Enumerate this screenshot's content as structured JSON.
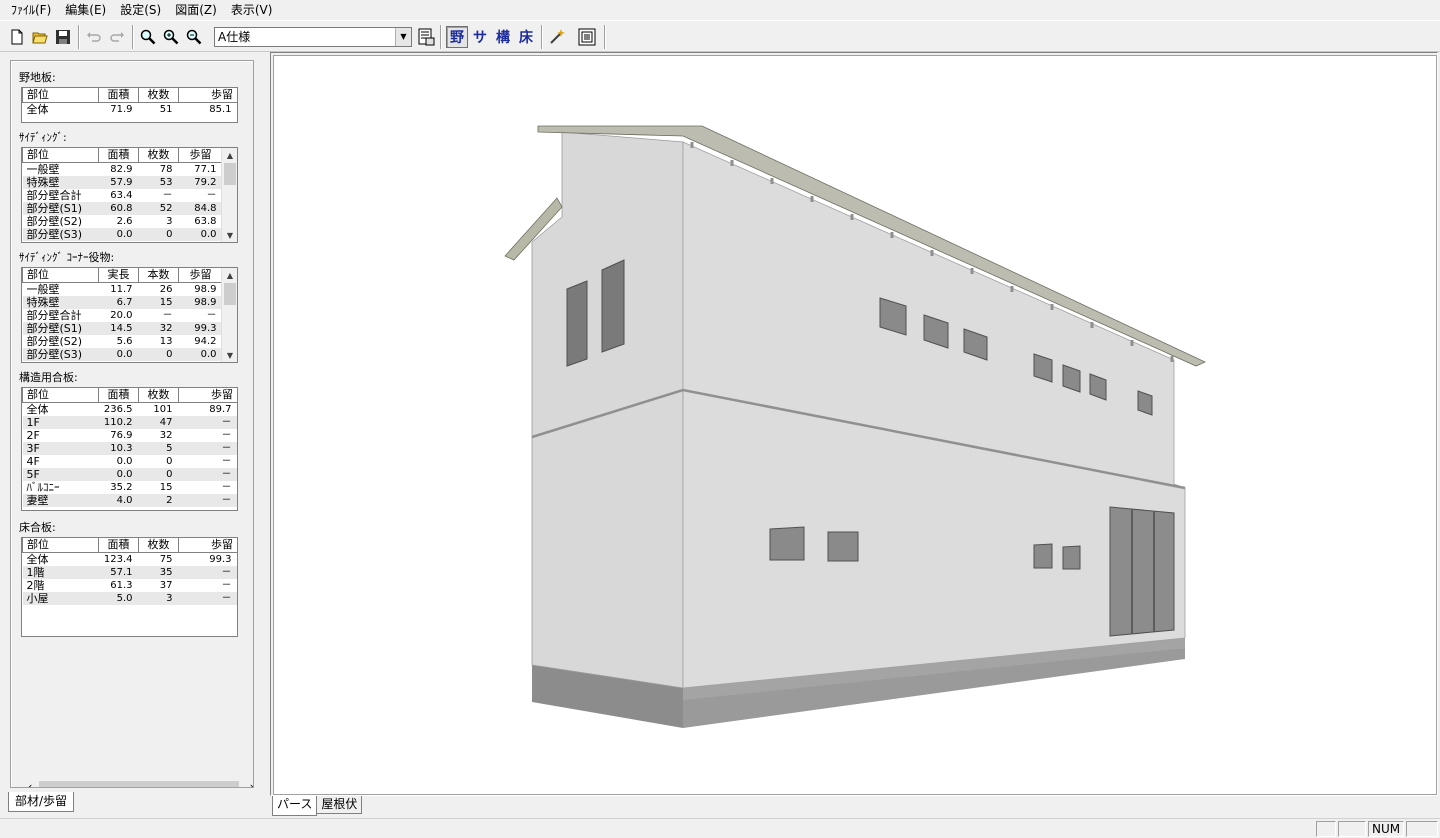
{
  "menu": [
    "ﾌｧｲﾙ(F)",
    "編集(E)",
    "設定(S)",
    "図面(Z)",
    "表示(V)"
  ],
  "toolbar": {
    "spec_value": "A仕様",
    "btn_nojiita": "野",
    "btn_siding": "サ",
    "btn_kouzou": "構",
    "btn_yuka": "床"
  },
  "panel": {
    "nojiita": {
      "title": "野地板:",
      "headers": [
        "部位",
        "面積",
        "枚数",
        "歩留"
      ],
      "rows": [
        [
          "全体",
          "71.9",
          "51",
          "85.1"
        ]
      ]
    },
    "siding": {
      "title": "ｻｲﾃﾞｨﾝｸﾞ:",
      "headers": [
        "部位",
        "面積",
        "枚数",
        "歩留"
      ],
      "rows": [
        [
          "一般壁",
          "82.9",
          "78",
          "77.1"
        ],
        [
          "特殊壁",
          "57.9",
          "53",
          "79.2"
        ],
        [
          "部分壁合計",
          "63.4",
          "－",
          "－"
        ],
        [
          "部分壁(S1)",
          "60.8",
          "52",
          "84.8"
        ],
        [
          "部分壁(S2)",
          "2.6",
          "3",
          "63.8"
        ],
        [
          "部分壁(S3)",
          "0.0",
          "0",
          "0.0"
        ]
      ]
    },
    "corner": {
      "title": "ｻｲﾃﾞｨﾝｸﾞ ｺｰﾅｰ役物:",
      "headers": [
        "部位",
        "実長",
        "本数",
        "歩留"
      ],
      "rows": [
        [
          "一般壁",
          "11.7",
          "26",
          "98.9"
        ],
        [
          "特殊壁",
          "6.7",
          "15",
          "98.9"
        ],
        [
          "部分壁合計",
          "20.0",
          "－",
          "－"
        ],
        [
          "部分壁(S1)",
          "14.5",
          "32",
          "99.3"
        ],
        [
          "部分壁(S2)",
          "5.6",
          "13",
          "94.2"
        ],
        [
          "部分壁(S3)",
          "0.0",
          "0",
          "0.0"
        ]
      ]
    },
    "kouzou": {
      "title": "構造用合板:",
      "headers": [
        "部位",
        "面積",
        "枚数",
        "歩留"
      ],
      "rows": [
        [
          "全体",
          "236.5",
          "101",
          "89.7"
        ],
        [
          "1F",
          "110.2",
          "47",
          "－"
        ],
        [
          "2F",
          "76.9",
          "32",
          "－"
        ],
        [
          "3F",
          "10.3",
          "5",
          "－"
        ],
        [
          "4F",
          "0.0",
          "0",
          "－"
        ],
        [
          "5F",
          "0.0",
          "0",
          "－"
        ],
        [
          "ﾊﾞﾙｺﾆｰ",
          "35.2",
          "15",
          "－"
        ],
        [
          "妻壁",
          "4.0",
          "2",
          "－"
        ]
      ]
    },
    "yuka": {
      "title": "床合板:",
      "headers": [
        "部位",
        "面積",
        "枚数",
        "歩留"
      ],
      "rows": [
        [
          "全体",
          "123.4",
          "75",
          "99.3"
        ],
        [
          "1階",
          "57.1",
          "35",
          "－"
        ],
        [
          "2階",
          "61.3",
          "37",
          "－"
        ],
        [
          "小屋",
          "5.0",
          "3",
          "－"
        ]
      ]
    },
    "tab_label": "部材/歩留"
  },
  "view_tabs": [
    "パース",
    "屋根伏"
  ],
  "status": {
    "num": "NUM"
  }
}
